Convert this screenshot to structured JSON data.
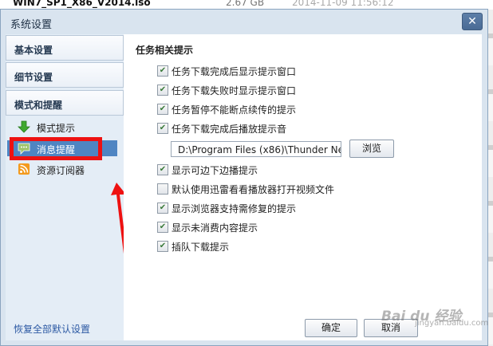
{
  "background": {
    "file_name": "WIN7_SP1_X86_V2014.iso",
    "file_size": "2.67 GB",
    "file_date": "2014-11-09 11:56:12"
  },
  "dialog": {
    "title": "系统设置",
    "close_glyph": "✕"
  },
  "sidebar": {
    "sections": [
      {
        "label": "基本设置"
      },
      {
        "label": "细节设置"
      },
      {
        "label": "模式和提醒"
      }
    ],
    "sub_items": [
      {
        "label": "模式提示",
        "icon": "green-down-arrow-icon"
      },
      {
        "label": "消息提醒",
        "icon": "message-icon",
        "active": true
      },
      {
        "label": "资源订阅器",
        "icon": "rss-icon"
      }
    ],
    "restore_label": "恢复全部默认设置"
  },
  "content": {
    "section_title": "任务相关提示",
    "options": [
      {
        "label": "任务下载完成后显示提示窗口",
        "checked": true
      },
      {
        "label": "任务下载失败时显示提示窗口",
        "checked": true
      },
      {
        "label": "任务暂停不能断点续传的提示",
        "checked": true
      },
      {
        "label": "任务下载完成后播放提示音",
        "checked": true
      },
      {
        "label": "显示可边下边播提示",
        "checked": true
      },
      {
        "label": "默认使用迅雷看看播放器打开视频文件",
        "checked": false
      },
      {
        "label": "显示浏览器支持需修复的提示",
        "checked": true
      },
      {
        "label": "显示未消费内容提示",
        "checked": true
      },
      {
        "label": "插队下载提示",
        "checked": true
      }
    ],
    "sound_path": "D:\\Program Files (x86)\\Thunder Ne",
    "browse_label": "浏览"
  },
  "footer": {
    "ok_label": "确定",
    "cancel_label": "取消"
  },
  "watermark": {
    "text": "Bai du 经验",
    "sub": "jingyan.baidu.com"
  },
  "colors": {
    "active_item": "#4f85c2",
    "highlight_box": "#ee1111",
    "annotation_arrow": "#ee1111"
  }
}
